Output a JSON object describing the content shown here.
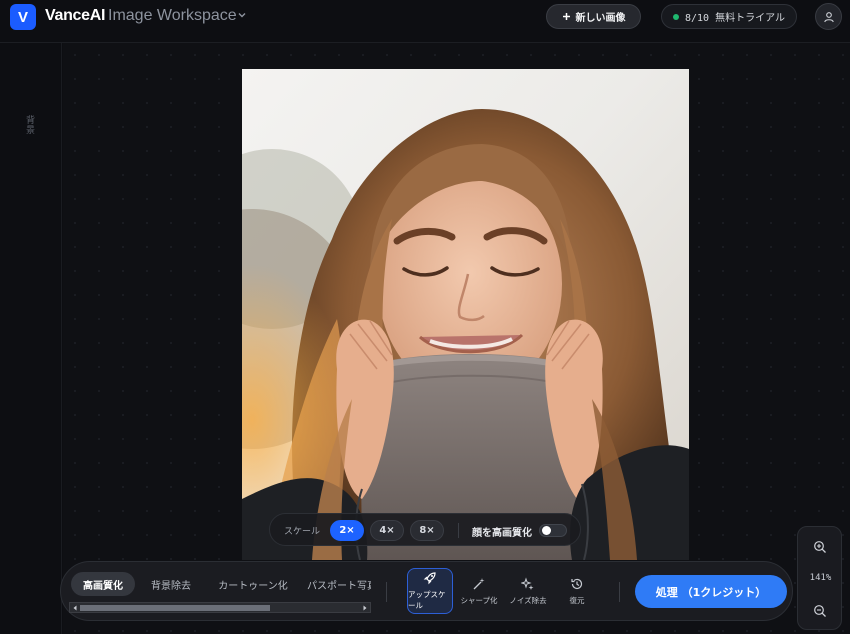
{
  "header": {
    "logo_letter": "V",
    "brand": "VanceAI",
    "workspace": "Image Workspace",
    "new_image_label": "新しい画像",
    "trial_label": "8/10 無料トライアル"
  },
  "sidebar": {
    "label": "背景"
  },
  "scale_bar": {
    "label": "スケール",
    "options": [
      "2×",
      "4×",
      "8×"
    ],
    "selected": "2×",
    "face_enhance_label": "顔を高画質化",
    "face_enhance_on": false
  },
  "toolbar": {
    "tabs": [
      "高画質化",
      "背景除去",
      "カートゥーン化",
      "パスポート写真"
    ],
    "active_tab": "高画質化",
    "tools": [
      {
        "label": "アップスケール",
        "icon": "rocket-icon"
      },
      {
        "label": "シャープ化",
        "icon": "magic-wand-icon"
      },
      {
        "label": "ノイズ除去",
        "icon": "sparkle-icon"
      },
      {
        "label": "復元",
        "icon": "history-icon"
      }
    ],
    "active_tool": "アップスケール",
    "process_label": "処理 （1クレジット）"
  },
  "zoom": {
    "level": "141%"
  },
  "colors": {
    "accent": "#1d63ff",
    "process": "#2f7bf6",
    "trial_dot": "#1fb86f"
  }
}
